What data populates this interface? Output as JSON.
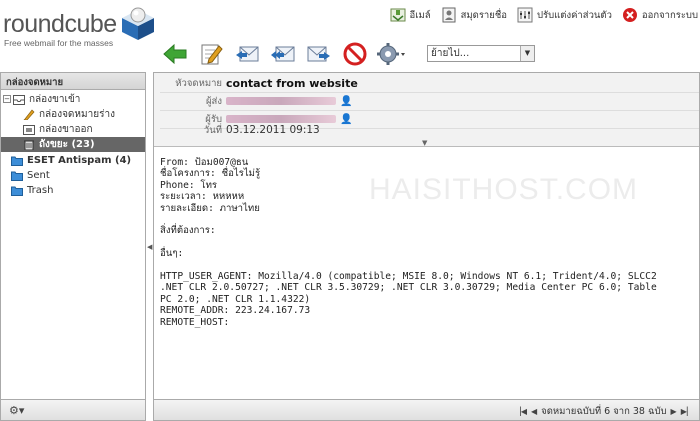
{
  "app": {
    "logo_text": "roundcube",
    "tagline": "Free webmail for the masses"
  },
  "toplinks": [
    {
      "label": "อีเมล์",
      "icon": "mail-icon"
    },
    {
      "label": "สมุดรายชื่อ",
      "icon": "addressbook-icon"
    },
    {
      "label": "ปรับแต่งค่าส่วนตัว",
      "icon": "settings-icon"
    },
    {
      "label": "ออกจากระบบ",
      "icon": "logout-icon"
    }
  ],
  "toolbar": {
    "move_select": "ย้ายไป..."
  },
  "sidebar": {
    "title": "กล่องจดหมาย",
    "folders": [
      {
        "label": "กล่องขาเข้า",
        "icon": "inbox-icon"
      },
      {
        "label": "กล่องจดหมายร่าง",
        "icon": "drafts-icon"
      },
      {
        "label": "กล่องขาออก",
        "icon": "sent-folder-icon"
      },
      {
        "label": "ถังขยะ (23)",
        "icon": "trash-icon"
      },
      {
        "label": "ESET Antispam (4)",
        "icon": "folder-icon"
      },
      {
        "label": "Sent",
        "icon": "folder-icon"
      },
      {
        "label": "Trash",
        "icon": "folder-icon"
      }
    ]
  },
  "message": {
    "subject_label": "หัวจดหมาย",
    "subject": "contact from website",
    "from_label": "ผู้ส่ง",
    "to_label": "ผู้รับ",
    "date_label": "วันที่",
    "date": "03.12.2011 09:13",
    "body_lines": [
      "From: ป้อม007@ธน",
      "ชื่อโครงการ: ชื่อไรไม่รู้",
      "Phone: โทร",
      "ระยะเวลา: หหหหห",
      "รายละเอียด: ภาษาไทย",
      "",
      "สิ่งที่ต้องการ:",
      "",
      "อื่นๆ:",
      "",
      "HTTP_USER_AGENT: Mozilla/4.0 (compatible; MSIE 8.0; Windows NT 6.1; Trident/4.0; SLCC2",
      ".NET CLR 2.0.50727; .NET CLR 3.5.30729; .NET CLR 3.0.30729; Media Center PC 6.0; Table",
      "PC 2.0; .NET CLR 1.1.4322)",
      "REMOTE_ADDR: 223.24.167.73",
      "REMOTE_HOST:"
    ]
  },
  "watermark": "HAISITHOST.COM",
  "pager": {
    "text": "จดหมายฉบับที่ 6 จาก 38 ฉบับ"
  },
  "colors": {
    "selected_folder_bg": "#666666",
    "accent_green": "#3fa535",
    "delete_red": "#d42020"
  }
}
